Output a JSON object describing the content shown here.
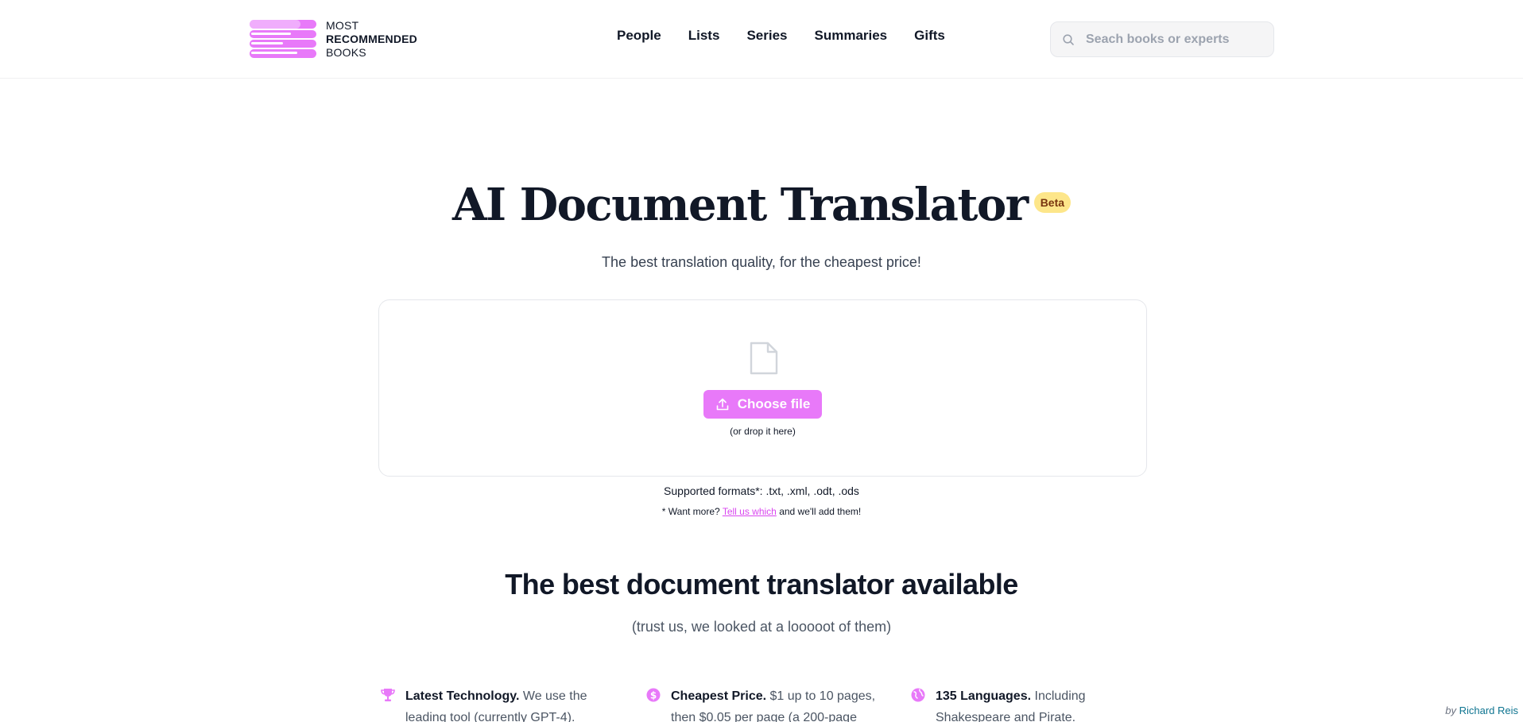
{
  "brand": {
    "line1": "MOST",
    "line2": "RECOMMENDED",
    "line3": "BOOKS",
    "accent": "#e879f9"
  },
  "nav": {
    "items": [
      "People",
      "Lists",
      "Series",
      "Summaries",
      "Gifts"
    ]
  },
  "search": {
    "placeholder": "Seach books or experts",
    "icon": "search-icon"
  },
  "hero": {
    "title": "AI Document Translator",
    "badge": "Beta",
    "subtitle": "The best translation quality, for the cheapest price!"
  },
  "upload": {
    "icon": "document-icon",
    "button_label": "Choose file",
    "button_icon": "upload-icon",
    "drop_hint": "(or drop it here)",
    "formats_text": "Supported formats*: .txt, .xml, .odt, .ods",
    "want_more_prefix": "* Want more?",
    "want_more_link": "Tell us which",
    "want_more_suffix": "and we'll add them!"
  },
  "section": {
    "title": "The best document translator available",
    "subtitle": "(trust us, we looked at a looooot of them)"
  },
  "features": [
    {
      "icon": "trophy-icon",
      "title": "Latest Technology.",
      "text": "We use the leading tool (currently GPT-4)."
    },
    {
      "icon": "dollar-icon",
      "title": "Cheapest Price.",
      "text": "$1 up to 10 pages, then $0.05 per page (a 200-page"
    },
    {
      "icon": "globe-icon",
      "title": "135 Languages.",
      "text": "Including Shakespeare and Pirate."
    }
  ],
  "credit": {
    "by": "by",
    "name": "Richard Reis"
  }
}
